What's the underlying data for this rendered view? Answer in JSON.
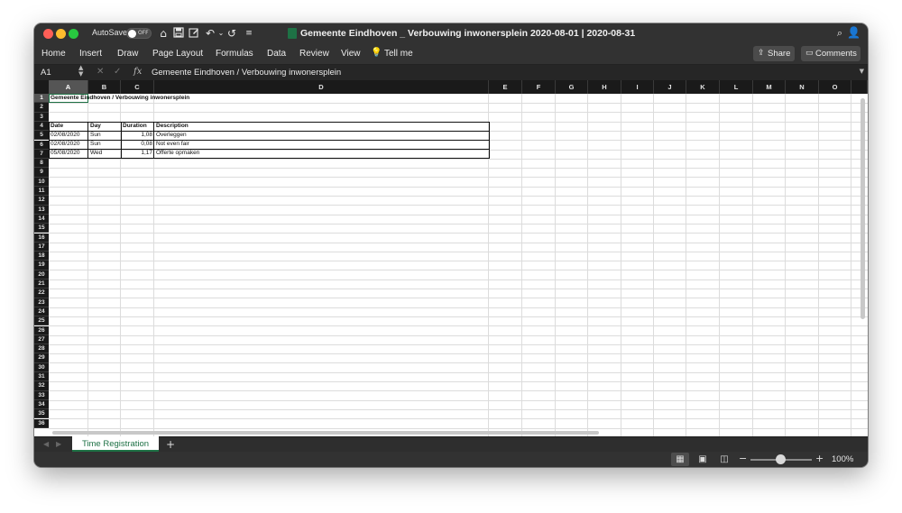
{
  "titlebar": {
    "autosave_label": "AutoSave",
    "autosave_state": "OFF",
    "document_title": "Gemeente Eindhoven _ Verbouwing inwonersplein 2020-08-01 | 2020-08-31"
  },
  "ribbon": {
    "tabs": [
      "Home",
      "Insert",
      "Draw",
      "Page Layout",
      "Formulas",
      "Data",
      "Review",
      "View",
      "Tell me"
    ],
    "share_label": "Share",
    "comments_label": "Comments"
  },
  "formula_bar": {
    "name_box": "A1",
    "fx_label": "fx",
    "content": "Gemeente Eindhoven / Verbouwing inwonersplein"
  },
  "grid": {
    "columns": [
      "A",
      "B",
      "C",
      "D",
      "E",
      "F",
      "G",
      "H",
      "I",
      "J",
      "K",
      "L",
      "M",
      "N",
      "O"
    ],
    "row_numbers": [
      "1",
      "2",
      "3",
      "4",
      "5",
      "6",
      "7",
      "8",
      "9",
      "10",
      "11",
      "12",
      "13",
      "14",
      "15",
      "16",
      "17",
      "18",
      "19",
      "20",
      "21",
      "22",
      "23",
      "24",
      "25",
      "26",
      "27",
      "28",
      "29",
      "30",
      "31",
      "32",
      "33",
      "34",
      "35",
      "36"
    ],
    "selected_cell": "A1",
    "title_cell": "Gemeente Eindhoven / Verbouwing inwonersplein",
    "table_headers": [
      "Date",
      "Day",
      "Duration",
      "Description"
    ],
    "table_rows": [
      [
        "02/08/2020",
        "Sun",
        "1,08",
        "Overleggen"
      ],
      [
        "02/08/2020",
        "Sun",
        "0,08",
        "Not even fair"
      ],
      [
        "05/08/2020",
        "Wed",
        "1,17",
        "Offerte opmaken"
      ]
    ]
  },
  "sheets": {
    "active_sheet": "Time Registration",
    "add_label": "+"
  },
  "statusbar": {
    "zoom_level": "100%",
    "zoom_fraction": 0.5
  },
  "colors": {
    "excel_green": "#1e7145",
    "chrome_dark": "#323232",
    "header_dark": "#1a1a1a"
  }
}
